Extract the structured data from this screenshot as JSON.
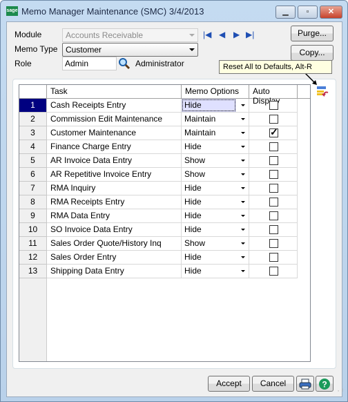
{
  "window": {
    "title": "Memo Manager Maintenance (SMC) 3/4/2013",
    "logo": "sage",
    "minimize_icon": "minimize-icon",
    "maximize_icon": "maximize-icon",
    "close_icon": "close-icon"
  },
  "form": {
    "module_label": "Module",
    "module_value": "Accounts Receivable",
    "memo_type_label": "Memo Type",
    "memo_type_value": "Customer",
    "role_label": "Role",
    "role_value": "Admin",
    "role_description": "Administrator",
    "purge_label": "Purge...",
    "copy_label": "Copy..."
  },
  "tooltip": "Reset All to Defaults, Alt-R",
  "grid": {
    "headers": [
      "",
      "Task",
      "Memo Options",
      "Auto Display"
    ],
    "rows": [
      {
        "num": "1",
        "task": "Cash Receipts Entry",
        "memo": "Hide",
        "auto": false
      },
      {
        "num": "2",
        "task": "Commission Edit Maintenance",
        "memo": "Maintain",
        "auto": false
      },
      {
        "num": "3",
        "task": "Customer Maintenance",
        "memo": "Maintain",
        "auto": true
      },
      {
        "num": "4",
        "task": "Finance Charge Entry",
        "memo": "Hide",
        "auto": false
      },
      {
        "num": "5",
        "task": "AR Invoice Data Entry",
        "memo": "Show",
        "auto": false
      },
      {
        "num": "6",
        "task": "AR Repetitive Invoice Entry",
        "memo": "Show",
        "auto": false
      },
      {
        "num": "7",
        "task": "RMA Inquiry",
        "memo": "Hide",
        "auto": false
      },
      {
        "num": "8",
        "task": "RMA Receipts Entry",
        "memo": "Hide",
        "auto": false
      },
      {
        "num": "9",
        "task": "RMA Data Entry",
        "memo": "Hide",
        "auto": false
      },
      {
        "num": "10",
        "task": "SO Invoice Data Entry",
        "memo": "Hide",
        "auto": false
      },
      {
        "num": "11",
        "task": "Sales Order Quote/History Inq",
        "memo": "Show",
        "auto": false
      },
      {
        "num": "12",
        "task": "Sales Order Entry",
        "memo": "Hide",
        "auto": false
      },
      {
        "num": "13",
        "task": "Shipping Data Entry",
        "memo": "Hide",
        "auto": false
      }
    ]
  },
  "footer": {
    "accept_label": "Accept",
    "cancel_label": "Cancel"
  }
}
